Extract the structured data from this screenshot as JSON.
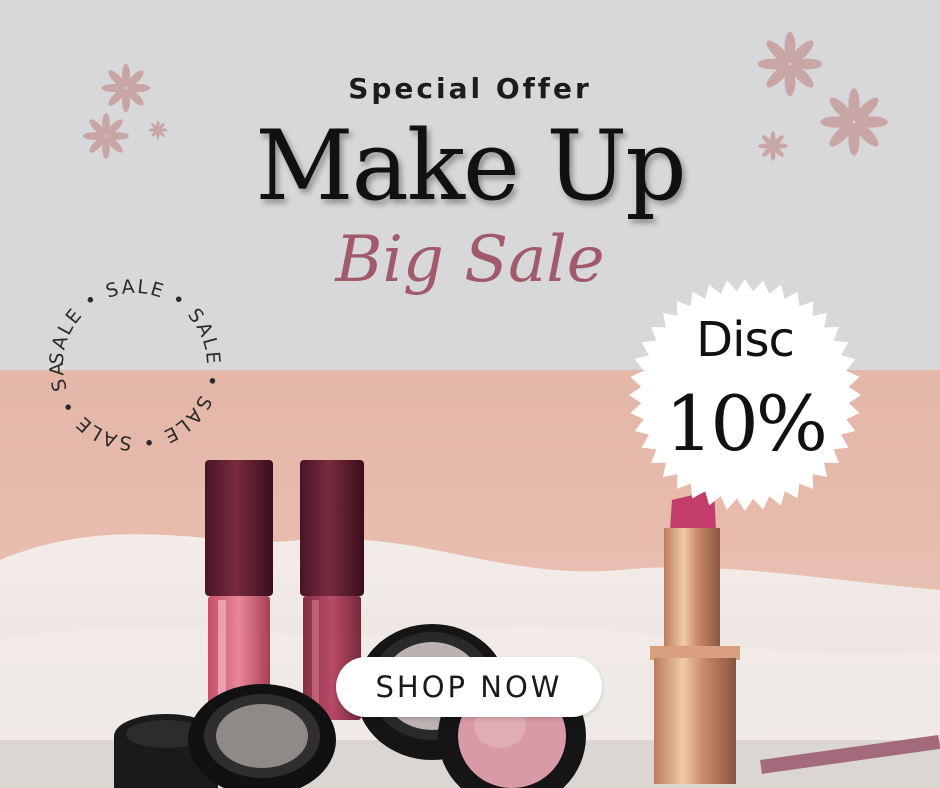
{
  "promo": {
    "eyebrow": "Special Offer",
    "headline": "Make Up",
    "subline": "Big Sale",
    "ring_text": "SALE • SALE • SALE • SALE • SALE • SALE • "
  },
  "discount": {
    "label": "Disc",
    "value": "10%"
  },
  "cta": {
    "label": "SHOP NOW"
  },
  "colors": {
    "accent_pink": "#a05a6a",
    "wall_pink": "#e4b7a7",
    "background_gray": "#d8d8da",
    "ink": "#111111",
    "star_flower": "#c9a6a6"
  },
  "icons": [
    "flower-icon",
    "starburst-badge",
    "lip-gloss",
    "lipstick",
    "compact"
  ]
}
